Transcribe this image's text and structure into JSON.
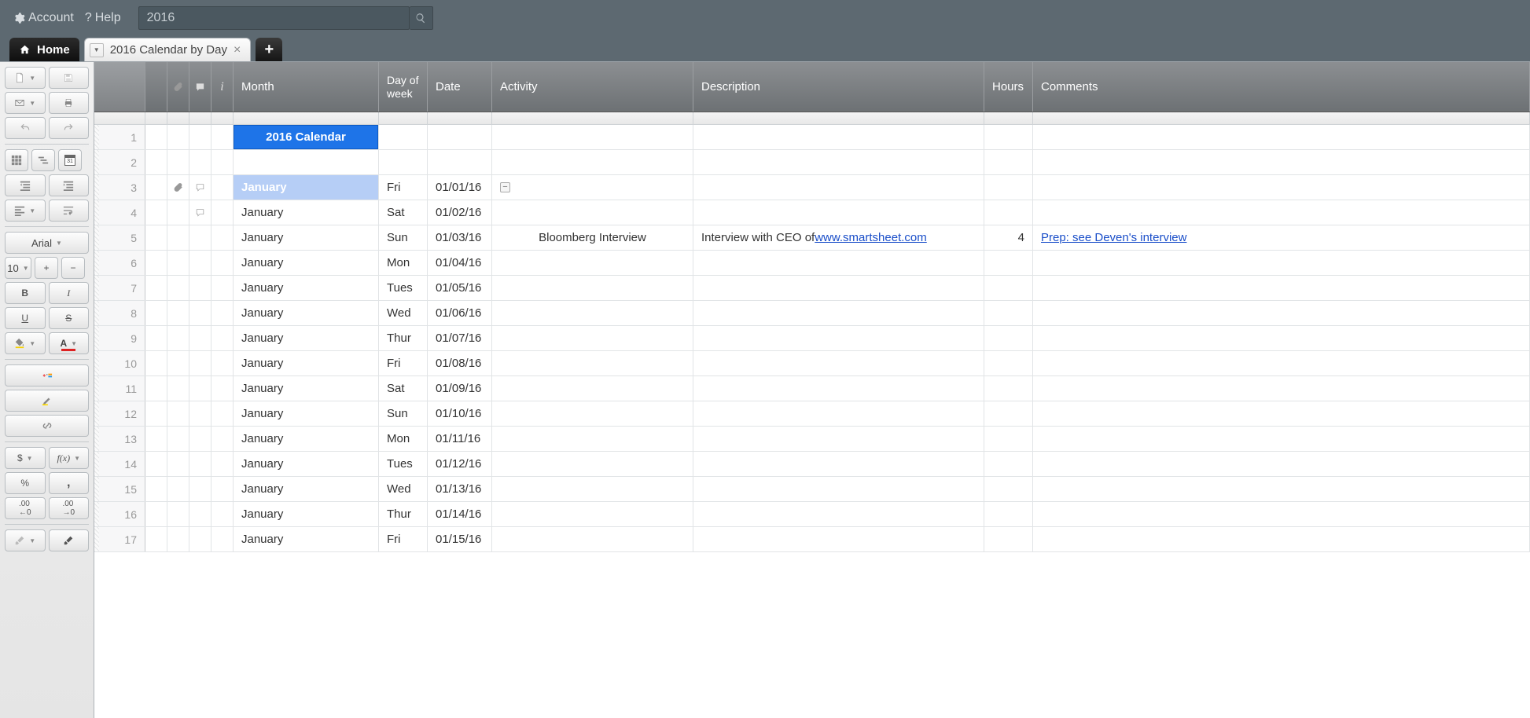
{
  "topbar": {
    "account_label": "Account",
    "help_label": "Help",
    "search_value": "2016"
  },
  "tabs": {
    "home_label": "Home",
    "doc_label": "2016 Calendar by Day"
  },
  "toolbar": {
    "font_name": "Arial",
    "font_size": "10",
    "bold": "B",
    "italic": "I",
    "underline": "U",
    "strike": "S",
    "currency": "$",
    "fx": "f(x)",
    "percent": "%",
    "thousands": ",",
    "dec_inc": ".00←",
    "dec_dec": ".00→",
    "plus": "+",
    "minus": "−"
  },
  "grid": {
    "headers": {
      "month": "Month",
      "dow": "Day of week",
      "date": "Date",
      "activity": "Activity",
      "desc": "Description",
      "hours": "Hours",
      "comments": "Comments"
    },
    "title_month": "2016 Calendar",
    "rows": [
      {
        "num": "1",
        "type": "title"
      },
      {
        "num": "2",
        "type": "blank"
      },
      {
        "num": "3",
        "type": "head",
        "clip": true,
        "bubble": true,
        "month": "January",
        "dow": "Fri",
        "date": "01/01/16",
        "collapse": true
      },
      {
        "num": "4",
        "type": "data",
        "bubble": true,
        "month": "January",
        "dow": "Sat",
        "date": "01/02/16"
      },
      {
        "num": "5",
        "type": "data",
        "month": "January",
        "dow": "Sun",
        "date": "01/03/16",
        "activity": "Bloomberg Interview",
        "desc_pre": "Interview with CEO of ",
        "desc_link": "www.smartsheet.com",
        "hours": "4",
        "comments_link": "Prep: see Deven's interview"
      },
      {
        "num": "6",
        "type": "data",
        "month": "January",
        "dow": "Mon",
        "date": "01/04/16"
      },
      {
        "num": "7",
        "type": "data",
        "month": "January",
        "dow": "Tues",
        "date": "01/05/16"
      },
      {
        "num": "8",
        "type": "data",
        "month": "January",
        "dow": "Wed",
        "date": "01/06/16"
      },
      {
        "num": "9",
        "type": "data",
        "month": "January",
        "dow": "Thur",
        "date": "01/07/16"
      },
      {
        "num": "10",
        "type": "data",
        "month": "January",
        "dow": "Fri",
        "date": "01/08/16"
      },
      {
        "num": "11",
        "type": "data",
        "month": "January",
        "dow": "Sat",
        "date": "01/09/16"
      },
      {
        "num": "12",
        "type": "data",
        "month": "January",
        "dow": "Sun",
        "date": "01/10/16"
      },
      {
        "num": "13",
        "type": "data",
        "month": "January",
        "dow": "Mon",
        "date": "01/11/16"
      },
      {
        "num": "14",
        "type": "data",
        "month": "January",
        "dow": "Tues",
        "date": "01/12/16"
      },
      {
        "num": "15",
        "type": "data",
        "month": "January",
        "dow": "Wed",
        "date": "01/13/16"
      },
      {
        "num": "16",
        "type": "data",
        "month": "January",
        "dow": "Thur",
        "date": "01/14/16"
      },
      {
        "num": "17",
        "type": "data",
        "month": "January",
        "dow": "Fri",
        "date": "01/15/16"
      }
    ]
  }
}
